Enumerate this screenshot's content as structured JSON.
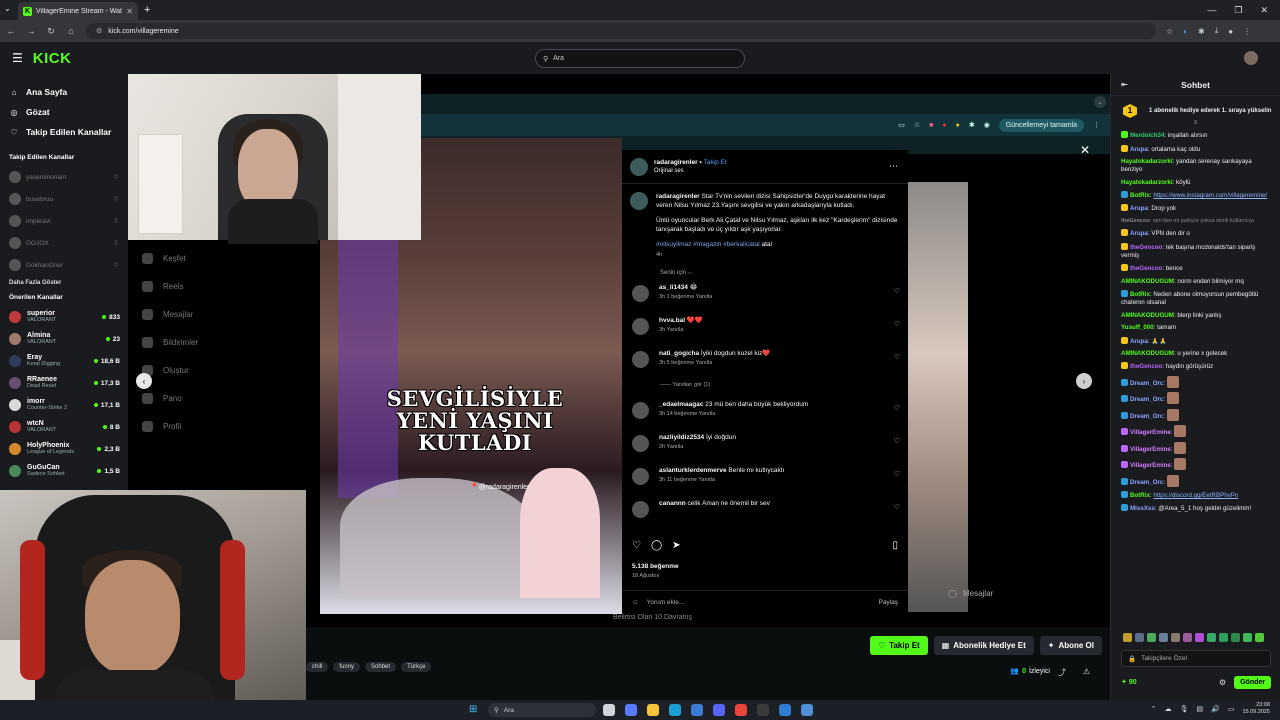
{
  "browser": {
    "tab_title": "VillagerEmine Stream - Wat",
    "tab_favicon": "K",
    "new_tab": "+",
    "url": "kick.com/villageremine"
  },
  "header": {
    "logo": "KICK",
    "search_placeholder": "Ara"
  },
  "sidebar": {
    "nav": [
      {
        "icon": "home-icon",
        "glyph": "⌂",
        "label": "Ana Sayfa"
      },
      {
        "icon": "compass-icon",
        "glyph": "◎",
        "label": "Gözat"
      },
      {
        "icon": "heart-icon",
        "glyph": "♡",
        "label": "Takip Edilen Kanallar"
      }
    ],
    "followed_title": "Takip Edilen Kanallar",
    "followed": [
      {
        "name": "yaseminonairr"
      },
      {
        "name": "busebruu"
      },
      {
        "name": "imperavi"
      },
      {
        "name": "GOJOX"
      },
      {
        "name": "GokhanOner"
      }
    ],
    "more_label": "Daha Fazla Göster",
    "recommended_title": "Önerilen Kanallar",
    "recommended": [
      {
        "name": "superior",
        "category": "VALORANT",
        "viewers": "833",
        "color": "#c23b3b"
      },
      {
        "name": "Almina",
        "category": "VALORANT",
        "viewers": "23",
        "color": "#a07a6b"
      },
      {
        "name": "Eray",
        "category": "Keep Digging",
        "viewers": "18,6 B",
        "color": "#2f3b5a"
      },
      {
        "name": "RRaenee",
        "category": "Dead Reset",
        "viewers": "17,3 B",
        "color": "#6a4b72"
      },
      {
        "name": "imorr",
        "category": "Counter-Strike 2",
        "viewers": "17,1 B",
        "color": "#d9d9d9"
      },
      {
        "name": "wtcN",
        "category": "VALORANT",
        "viewers": "8 B",
        "color": "#b83434"
      },
      {
        "name": "HolyPhoenix",
        "category": "League of Legends",
        "viewers": "2,3 B",
        "color": "#d48a2c"
      },
      {
        "name": "GuGuCan",
        "category": "Sadece Sohbet",
        "viewers": "1,5 B",
        "color": "#4a8a5a"
      }
    ]
  },
  "stream": {
    "inner_update_label": "Güncellemeyi tamamla",
    "ig_nav": [
      "Keşfet",
      "Reels",
      "Mesajlar",
      "Bildirimler",
      "Oluştur",
      "Pano",
      "Profil"
    ],
    "video_caption": "SEVGİLİSİYLE YENİ YAŞINI KUTLADI",
    "video_tag": "📍@radaragirenler",
    "post": {
      "account": "radaragirenler",
      "follow": "Takip Et",
      "audio": "Orijinal ses",
      "caption_user": "radaragirenler",
      "caption_1": "Star Tv'nin sevilen dizisi Sahipsizler'de Duygu karakterine hayat veren Nilsu Yılmaz 23.Yaşını sevgilisi ve yakın arkadaşlarıyla kutladı.",
      "caption_2": "Ünlü oyuncular Berk Ali Çatal ve Nilsu Yılmaz, aşkları ilk kez \"Kardeşlerim\" dizisinde tanışarak başladı ve üç yıldır aşk yaşıyorlar.",
      "tags": "#nilsuyilmaz #magazin #berkalicatal",
      "tags_tail": "atal",
      "time_ago": "4h",
      "for_you": "Senin için ⌵",
      "comments": [
        {
          "user": "as_li1434",
          "text": "😂",
          "meta": "3h   1 beğenme   Yanıtla"
        },
        {
          "user": "hvva.bal",
          "text": "❤️❤️",
          "meta": "3h   Yanıtla"
        },
        {
          "user": "nati_gogicha",
          "text": "İyiki dogdun kuzel kiz❤️",
          "meta": "3h   5 beğenme   Yanıtla"
        },
        {
          "user": "_edaelmaagac",
          "text": "23 mü ben daha büyük bekliyordum",
          "meta": "3h   14 beğenme   Yanıtla"
        },
        {
          "user": "nazliyildiz2534",
          "text": "İyi doğdun",
          "meta": "2h   Yanıtla"
        },
        {
          "user": "aslanturklerdenmerve",
          "text": "Benle mi kutlıycaktı",
          "meta": "3h   11 beğenme   Yanıtla"
        },
        {
          "user": "canannn",
          "text": "celik Aman ne önemli bir sev",
          "meta": ""
        }
      ],
      "replies_label": "——   Yanıtları gör (1)",
      "likes": "5.138 beğenme",
      "date": "18 Ağustos",
      "add_comment": "Yorum ekle...",
      "post_btn": "Paylaş"
    },
    "ghost_messages": "Mesajlar",
    "bottom_label": "Belirtisi Olan 10 Davranış"
  },
  "streambar": {
    "chips": [
      "chill",
      "funny",
      "Sohbet",
      "Türkçe"
    ],
    "follow_label": "Takip Et",
    "gift_label": "Abonelik Hediye Et",
    "sub_label": "Abone Ol",
    "viewers_count": "0",
    "viewers_label": "İzleyici"
  },
  "chat": {
    "title": "Sohbet",
    "pinned": "1 abonelik hediye ederek 1. sıraya yükselin",
    "messages": [
      {
        "user": "Merdoich34",
        "color": "#2ecc71",
        "badge": "#53fc18",
        "text": "inşallah alırsın"
      },
      {
        "user": "Arupa",
        "color": "#8aa4ff",
        "badge": "#f5c518",
        "text": "ortalama kaç oldu"
      },
      {
        "user": "Hayatokadarzorki",
        "color": "#53fc18",
        "badge": "",
        "text": "yandan serenay sarıkayaya benziyo"
      },
      {
        "user": "Hayatokadarzorki",
        "color": "#53fc18",
        "badge": "",
        "text": "köylü"
      },
      {
        "user": "BotRix",
        "color": "#53fc18",
        "badge": "#2d9cdb",
        "text": "",
        "link": "https://www.instagram.com/villageremine/"
      },
      {
        "user": "Arupa",
        "color": "#8aa4ff",
        "badge": "#f5c518",
        "text": "Drop yok"
      },
      {
        "user": "theGencoo",
        "color": "#888",
        "badge": "",
        "text": "vpn'den mi patlıyor yoksa isimli kullanıcıyı",
        "dim": true
      },
      {
        "user": "Arupa",
        "color": "#8aa4ff",
        "badge": "#f5c518",
        "text": "VPN den dir o"
      },
      {
        "user": "theGencoo",
        "color": "#b967ff",
        "badge": "#f5c518",
        "text": "tek başına mcdonalds'tan sipariş vermiş"
      },
      {
        "user": "theGencoo",
        "color": "#b967ff",
        "badge": "#f5c518",
        "text": "bence"
      },
      {
        "user": "AMINAKODUGUM",
        "color": "#53fc18",
        "badge": "",
        "text": "norm enderi bilmiyor mq"
      },
      {
        "user": "BotRix",
        "color": "#53fc18",
        "badge": "#2d9cdb",
        "text": "Neden abone olmuyorsun pembegötlü chatenın olsana!"
      },
      {
        "user": "AMINAKODUGUM",
        "color": "#53fc18",
        "badge": "",
        "text": "blerp linki yanlış"
      },
      {
        "user": "Yusuff_000",
        "color": "#53fc18",
        "badge": "",
        "text": "tamam"
      },
      {
        "user": "Arupa",
        "color": "#8aa4ff",
        "badge": "#f5c518",
        "text": "🙏🙏"
      },
      {
        "user": "AMINAKODUGUM",
        "color": "#53fc18",
        "badge": "",
        "text": "u yerine x gelecek"
      },
      {
        "user": "theGencoo",
        "color": "#b967ff",
        "badge": "#f5c518",
        "text": "haydin görüşürüz"
      },
      {
        "user": "Dream_Orc",
        "color": "#8aa4ff",
        "badge": "#2d9cdb",
        "text": "",
        "emote": true
      },
      {
        "user": "Dream_Orc",
        "color": "#8aa4ff",
        "badge": "#2d9cdb",
        "text": "",
        "emote": true
      },
      {
        "user": "Dream_Orc",
        "color": "#8aa4ff",
        "badge": "#2d9cdb",
        "text": "",
        "emote": true
      },
      {
        "user": "VillagerEmine",
        "color": "#d57cff",
        "badge": "#b967ff",
        "text": "",
        "emote": true
      },
      {
        "user": "VillagerEmine",
        "color": "#d57cff",
        "badge": "#b967ff",
        "text": "",
        "emote": true
      },
      {
        "user": "VillagerEmine",
        "color": "#d57cff",
        "badge": "#b967ff",
        "text": "",
        "emote": true
      },
      {
        "user": "Dream_Orc",
        "color": "#8aa4ff",
        "badge": "#2d9cdb",
        "text": "",
        "emote": true
      },
      {
        "user": "BotRix",
        "color": "#53fc18",
        "badge": "#2d9cdb",
        "text": "",
        "link": "https://discord.gg/EetRBPhvPn"
      },
      {
        "user": "MissXss",
        "color": "#8aa4ff",
        "badge": "#2d9cdb",
        "text": "@Area_5_1 hoş geldin güzelimm!"
      }
    ],
    "input_placeholder": "Takipçilere Özel",
    "points": "90",
    "send_label": "Gönder"
  },
  "taskbar": {
    "search_placeholder": "Ara",
    "time": "23:08",
    "date": "15.09.2025"
  },
  "colors": {
    "kick_green": "#53fc18",
    "panel": "#191b1f",
    "background": "#0b0e0f"
  }
}
